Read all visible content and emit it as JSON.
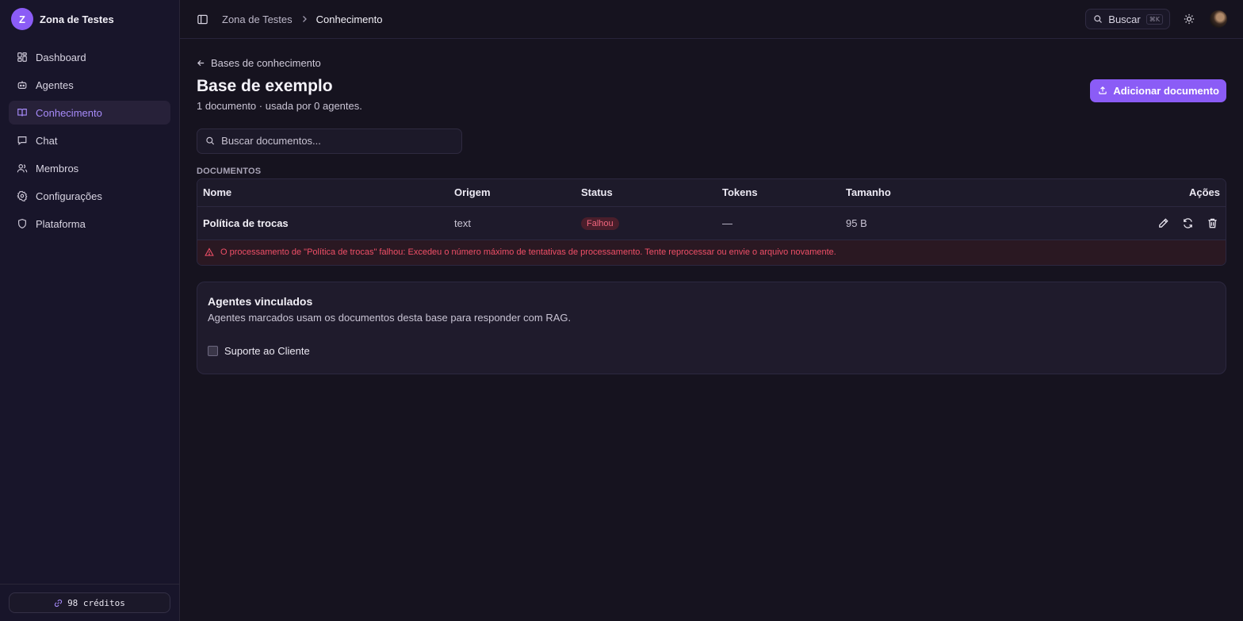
{
  "workspace": {
    "initial": "Z",
    "name": "Zona de Testes"
  },
  "sidebar": {
    "items": [
      {
        "label": "Dashboard",
        "icon": "dashboard-icon"
      },
      {
        "label": "Agentes",
        "icon": "bot-icon"
      },
      {
        "label": "Conhecimento",
        "icon": "book-icon",
        "active": true
      },
      {
        "label": "Chat",
        "icon": "chat-icon"
      },
      {
        "label": "Membros",
        "icon": "users-icon"
      },
      {
        "label": "Configurações",
        "icon": "gear-icon"
      },
      {
        "label": "Plataforma",
        "icon": "shield-icon"
      }
    ],
    "credits": "98 créditos"
  },
  "topbar": {
    "breadcrumb": [
      "Zona de Testes",
      "Conhecimento"
    ],
    "search_label": "Buscar",
    "search_shortcut": "⌘K"
  },
  "page": {
    "back_label": "Bases de conhecimento",
    "title": "Base de exemplo",
    "subtitle": "1 documento · usada por 0 agentes.",
    "add_button": "Adicionar documento",
    "search_placeholder": "Buscar documentos...",
    "section_label": "DOCUMENTOS"
  },
  "table": {
    "headers": [
      "Nome",
      "Origem",
      "Status",
      "Tokens",
      "Tamanho",
      "Ações"
    ],
    "rows": [
      {
        "name": "Política de trocas",
        "origin": "text",
        "status": "Falhou",
        "tokens": "—",
        "size": "95 B"
      }
    ],
    "error": "O processamento de \"Política de trocas\" falhou: Excedeu o número máximo de tentativas de processamento. Tente reprocessar ou envie o arquivo novamente."
  },
  "linked_agents": {
    "title": "Agentes vinculados",
    "description": "Agentes marcados usam os documentos desta base para responder com RAG.",
    "agents": [
      {
        "label": "Suporte ao Cliente",
        "checked": false
      }
    ]
  },
  "colors": {
    "accent": "#8b5cf6",
    "error": "#ef4f67",
    "background": "#16131f"
  }
}
